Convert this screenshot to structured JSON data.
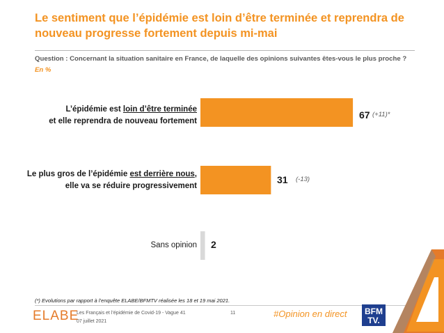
{
  "slide": {
    "title": "Le sentiment que l’épidémie est loin d’être terminée et reprendra de nouveau progresse fortement depuis mi-mai",
    "question": "Question : Concernant la situation sanitaire en France, de laquelle des opinions suivantes êtes-vous le plus proche ?",
    "unit": "En %",
    "footnote": "(*) Evolutions par rapport à l’enquête ELABE/BFMTV réalisée les 18 et 19 mai 2021.",
    "footer": {
      "logo": "ELABE",
      "survey": "Les Français et l’épidémie de Covid-19 - Vague 41",
      "date": "07 juillet 2021",
      "page": "11",
      "hashtag": "#Opinion en direct",
      "partner_logo": "BFM TV"
    }
  },
  "labels": {
    "cat1_line1_a": "L’épidémie est ",
    "cat1_line1_u": "loin d’être terminée",
    "cat1_line2": "et elle reprendra de nouveau fortement",
    "cat2_line1_a": "Le plus gros de l’épidémie ",
    "cat2_line1_u": "est derrière nous",
    "cat2_line1_c": ",",
    "cat2_line2": "elle va se réduire progressivement",
    "cat3": "Sans opinion"
  },
  "chart_data": {
    "type": "bar",
    "orientation": "horizontal",
    "categories": [
      "L’épidémie est loin d’être terminée et elle reprendra de nouveau fortement",
      "Le plus gros de l’épidémie est derrière nous, elle va se réduire progressivement",
      "Sans opinion"
    ],
    "values": [
      67,
      31,
      2
    ],
    "value_labels": [
      "67",
      "31",
      "2"
    ],
    "deltas": [
      "(+11)*",
      "(-13)",
      ""
    ],
    "colors": [
      "#f39322",
      "#f39322",
      "#d9d9d9"
    ],
    "xlim": [
      0,
      100
    ],
    "grid": false,
    "legend": "none"
  }
}
